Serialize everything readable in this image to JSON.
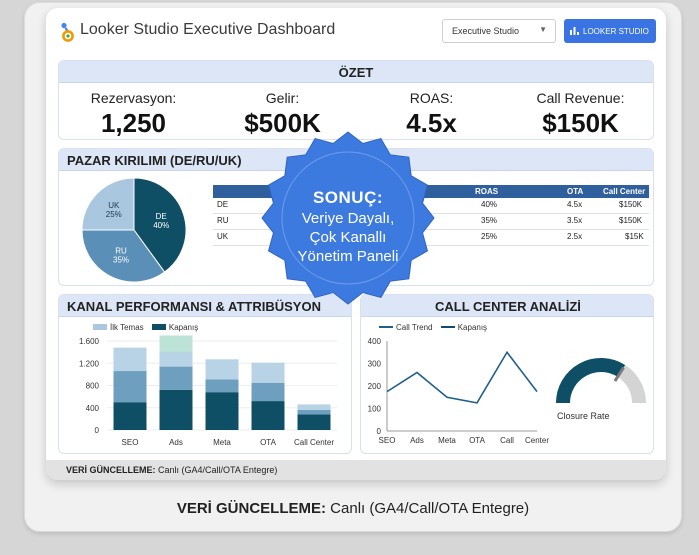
{
  "header": {
    "title": "Looker Studio Executive Dashboard",
    "dropdown_value": "Executive Studio",
    "button_label": "LOOKER STUDIO"
  },
  "summary": {
    "title": "ÖZET",
    "kpis": [
      {
        "label": "Rezervasyon:",
        "value": "1,250"
      },
      {
        "label": "Gelir:",
        "value": "$500K"
      },
      {
        "label": "ROAS:",
        "value": "4.5x"
      },
      {
        "label": "Call Revenue:",
        "value": "$150K"
      }
    ]
  },
  "market": {
    "title": "PAZAR KIRILIMI (DE/RU/UK)",
    "pie": [
      {
        "label": "DE",
        "pct_label": "40%",
        "value": 40,
        "color": "#0f4f66"
      },
      {
        "label": "RU",
        "pct_label": "35%",
        "value": 35,
        "color": "#5a8fb8"
      },
      {
        "label": "UK",
        "pct_label": "25%",
        "value": 25,
        "color": "#a9c7df"
      }
    ],
    "table": {
      "headers": [
        "ROAS",
        "OTA",
        "Call Center"
      ],
      "rows": [
        {
          "market": "DE",
          "roas": "40%",
          "ota": "4.5x",
          "call": "$150K"
        },
        {
          "market": "RU",
          "roas": "35%",
          "ota": "3.5x",
          "call": "$150K"
        },
        {
          "market": "UK",
          "roas": "25%",
          "ota": "2.5x",
          "call": "$15K"
        }
      ]
    }
  },
  "badge": {
    "line1": "SONUÇ:",
    "line2": "Veriye Dayalı,",
    "line3": "Çok Kanallı",
    "line4": "Yönetim Paneli"
  },
  "channel": {
    "title": "KANAL PERFORMANSI & ATTRIBÜSYON"
  },
  "callcenter": {
    "title": "CALL CENTER ANALİZİ",
    "gauge_label": "Closure Rate"
  },
  "footer": {
    "label": "VERİ GÜNCELLEME:",
    "text": " Canlı (GA4/Call/OTA Entegre)"
  },
  "caption": {
    "label": "VERİ GÜNCELLEME:",
    "text": " Canlı (GA4/Call/OTA Entegre)"
  },
  "colors": {
    "accent": "#3a74e3",
    "badge": "#3d7ae0",
    "section_header": "#dce6f7",
    "navy": "#0f4f66",
    "light_blue": "#a9c7df",
    "mint": "#bde3d6"
  },
  "chart_data": [
    {
      "type": "bar",
      "categories": [
        "SEO",
        "Ads",
        "Meta",
        "OTA",
        "Call Center"
      ],
      "yticks": [
        "0",
        "400",
        "800",
        "1.200",
        "1.600"
      ],
      "ylim": [
        0,
        1600
      ],
      "series": [
        {
          "name": "Kapanış",
          "values": [
            500,
            720,
            680,
            520,
            280
          ],
          "color": "#0f4f66"
        },
        {
          "name": "İlk Temas",
          "values": [
            560,
            420,
            230,
            330,
            80
          ],
          "color": "#6e9fbf"
        },
        {
          "name": "",
          "values": [
            420,
            270,
            360,
            360,
            100
          ],
          "color": "#b8d2e6"
        }
      ],
      "extra_top": {
        "category": "Ads",
        "value": 290,
        "color": "#bde3d6"
      },
      "legend": [
        {
          "name": "İlk Temas",
          "color": "#a9c7df"
        },
        {
          "name": "Kapanış",
          "color": "#0f4f66"
        }
      ]
    },
    {
      "type": "line",
      "categories": [
        "SEO",
        "Ads",
        "Meta",
        "OTA",
        "Call",
        "Center"
      ],
      "yticks": [
        "0",
        "100",
        "200",
        "300",
        "400"
      ],
      "ylim": [
        0,
        400
      ],
      "series": [
        {
          "name": "Call Trend",
          "values": [
            175,
            260,
            150,
            125,
            350,
            175
          ],
          "color": "#1f5f8b"
        }
      ],
      "legend": [
        {
          "name": "Call Trend",
          "color": "#1f5f8b"
        },
        {
          "name": "Kapanış",
          "color": "#0f4f66"
        }
      ]
    },
    {
      "type": "gauge",
      "label": "Closure Rate",
      "value": 0.68
    }
  ]
}
